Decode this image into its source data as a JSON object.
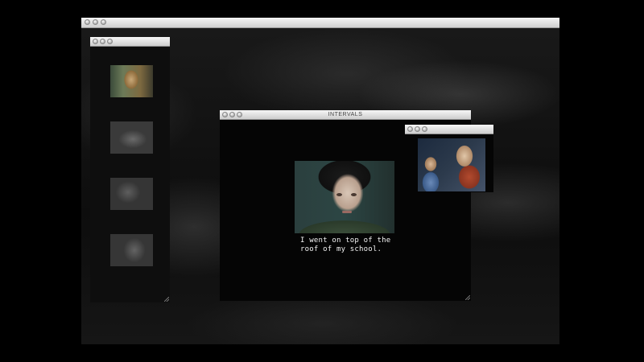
{
  "main_window": {
    "title": "INTERVALS",
    "subtitle": "I went on top of the\nroof of my school."
  },
  "thumbnails_window": {
    "title": "",
    "thumbnails": [
      "video-thumbnail-1",
      "video-thumbnail-2",
      "video-thumbnail-3",
      "video-thumbnail-4"
    ]
  },
  "photo_window": {
    "title": ""
  },
  "colors": {
    "titlebar": "#d8d8d8",
    "window_bg": "#050505",
    "subtitle_text": "#f2f2f2"
  }
}
